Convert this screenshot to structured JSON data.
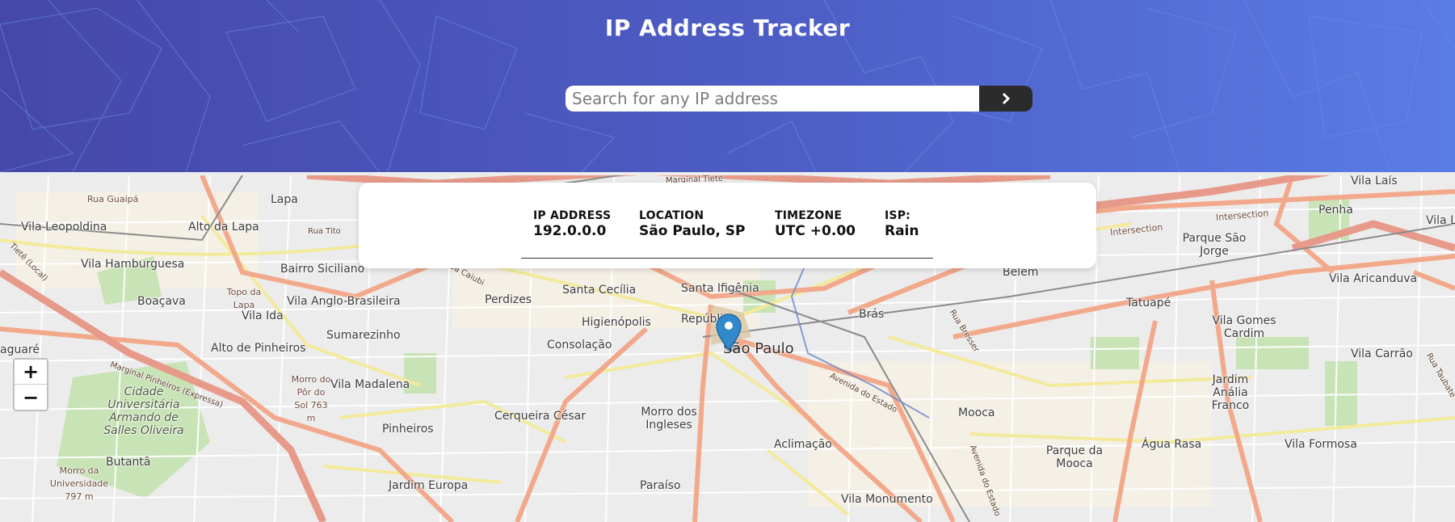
{
  "header": {
    "title": "IP Address Tracker"
  },
  "search": {
    "placeholder": "Search for any IP address",
    "value": "",
    "button_icon": "chevron-right-icon"
  },
  "info": {
    "ip_label": "IP ADDRESS",
    "ip_value": "192.0.0.0",
    "location_label": "LOCATION",
    "location_value": "São Paulo, SP",
    "timezone_label": "TIMEZONE",
    "timezone_value": "UTC +0.00",
    "isp_label": "ISP:",
    "isp_value": "Rain"
  },
  "map": {
    "zoom_in": "+",
    "zoom_out": "−",
    "marker_icon": "map-pin-icon",
    "labels": {
      "rua_guaipa": "Rua Guaipá",
      "lapa": "Lapa",
      "vila_leopoldina": "Vila Leopoldina",
      "alto_da_lapa": "Alto da Lapa",
      "rua_tito": "Rua Tito",
      "vila_hamburguesa": "Vila Hamburguesa",
      "bairro_siciliano": "Bairro Siciliano",
      "boacava": "Boaçava",
      "topo_da_lapa": "Topo da Lapa",
      "vila_anglo": "Vila Anglo-Brasileira",
      "perdizes": "Perdizes",
      "santa_cecilia": "Santa Cecília",
      "santa_ifigenia": "Santa Ifigênia",
      "vila_ida": "Vila Ida",
      "sumarezinho": "Sumarezinho",
      "higienopolis": "Higienópolis",
      "republica": "República",
      "bras": "Brás",
      "alto_pinheiros": "Alto de Pinheiros",
      "consolacao": "Consolação",
      "sao_paulo": "São Paulo",
      "aguare": "aguaré",
      "cidade_universitaria": "Cidade Universitária Armando de Salles Oliveira",
      "morro_do_sol": "Morro do Pôr do Sol 763 m",
      "vila_madalena": "Vila Madalena",
      "cerqueira_cesar": "Cerqueira César",
      "morro_ingleses": "Morro dos Ingleses",
      "pinheiros": "Pinheiros",
      "butanta": "Butantã",
      "morro_universidade": "Morro da Universidade 797 m",
      "jardim_europa": "Jardim Europa",
      "paraiso": "Paraíso",
      "aclimacao": "Aclimação",
      "vila_monumento": "Vila Monumento",
      "mooca": "Mooca",
      "parque_da_mooca": "Parque da Mooca",
      "agua_rasa": "Água Rasa",
      "vila_formosa": "Vila Formosa",
      "jardim_analia": "Jardim Anália Franco",
      "vila_carrao": "Vila Carrão",
      "vila_gomes": "Vila Gomes Cardim",
      "tatuape": "Tatuapé",
      "vila_aricanduva": "Vila Aricanduva",
      "belem": "Belém",
      "parque_sao_jorge": "Parque São Jorge",
      "penha": "Penha",
      "vila_lais": "Vila Laís",
      "vila_l": "Vila L",
      "intersection1": "Intersection",
      "intersection2": "Intersection",
      "marginal_tiete": "Marginal Tietê",
      "marginal_pinheiros": "Marginal Pinheiros (Expressa)",
      "avenida_estado": "Avenida do Estado",
      "avenida_estado2": "Avenida do Estado",
      "rua_caiubi": "Rua Caiubi",
      "rua_bresser": "Rua Bresser",
      "tiete_local": "Tietê (Local)",
      "rua_taubate": "Rua Taubaté"
    }
  }
}
